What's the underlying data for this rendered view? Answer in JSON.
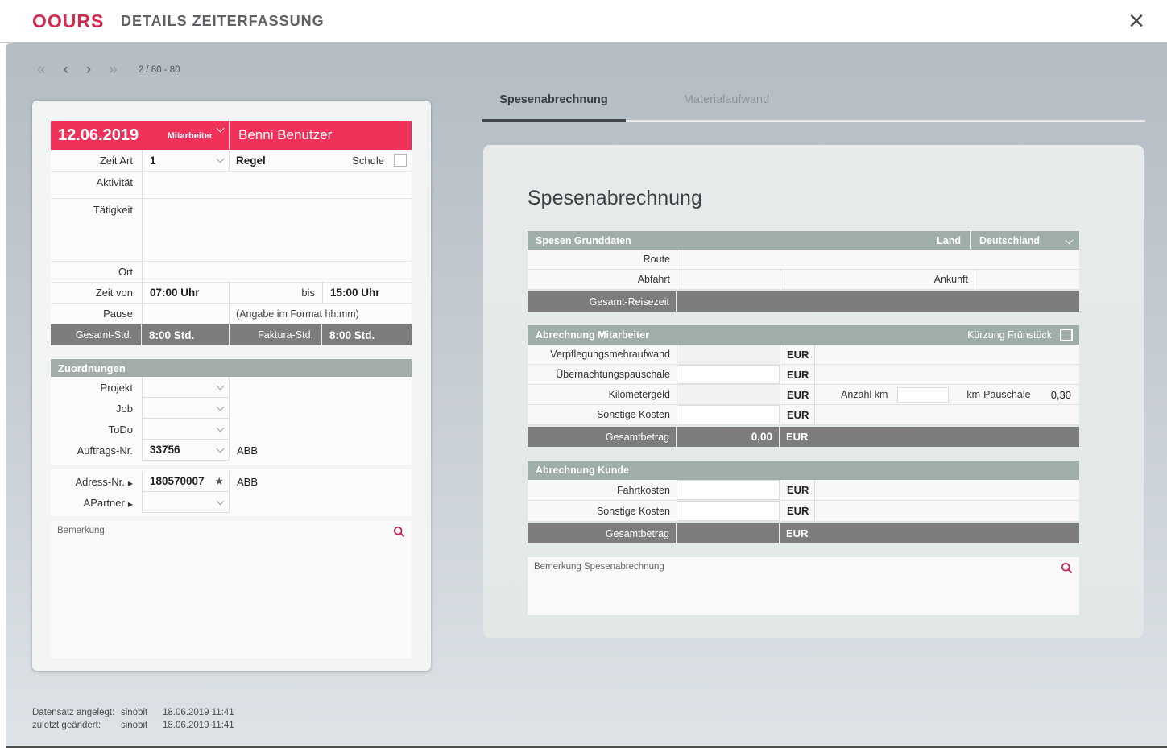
{
  "header": {
    "logo": "OOURS",
    "title": "DETAILS ZEITERFASSUNG"
  },
  "pager": {
    "first": "«",
    "prev": "‹",
    "next": "›",
    "last": "»",
    "position": "2 / 80 - 80"
  },
  "entry_card": {
    "date": "12.06.2019",
    "role_label": "Mitarbeiter",
    "user_name": "Benni Benutzer",
    "zeit_art": {
      "label": "Zeit Art",
      "value": "1",
      "type_name": "Regel",
      "schule_label": "Schule"
    },
    "aktivitaet_label": "Aktivität",
    "taetigkeit_label": "Tätigkeit",
    "ort_label": "Ort",
    "zeit_von": {
      "label": "Zeit von",
      "value": "07:00 Uhr",
      "bis_label": "bis",
      "bis_value": "15:00 Uhr"
    },
    "pause": {
      "label": "Pause",
      "hint": "(Angabe im Format hh:mm)"
    },
    "totals": {
      "gesamt_label": "Gesamt-Std.",
      "gesamt_value": "8:00 Std.",
      "faktura_label": "Faktura-Std.",
      "faktura_value": "8:00 Std."
    },
    "zuordnungen": {
      "title": "Zuordnungen",
      "projekt_label": "Projekt",
      "job_label": "Job",
      "todo_label": "ToDo",
      "auftrag_label": "Auftrags-Nr.",
      "auftrag_value": "33756",
      "auftrag_info": "ABB"
    },
    "adresse": {
      "adress_label": "Adress-Nr.",
      "adress_value": "180570007",
      "adress_info": "ABB",
      "apartner_label": "APartner",
      "arrow": "▶",
      "star": "★"
    },
    "bemerkung_label": "Bemerkung"
  },
  "tabs": [
    {
      "label": "Spesenabrechnung",
      "active": true
    },
    {
      "label": "Materialaufwand",
      "active": false
    }
  ],
  "expense_panel": {
    "title": "Spesenabrechnung",
    "currency": "EUR",
    "grunddaten": {
      "title": "Spesen Grunddaten",
      "land_label": "Land",
      "land_value": "Deutschland",
      "route_label": "Route",
      "abfahrt_label": "Abfahrt",
      "ankunft_label": "Ankunft",
      "reisezeit_label": "Gesamt-Reisezeit"
    },
    "mitarbeiter": {
      "title": "Abrechnung Mitarbeiter",
      "kuerzung_label": "Kürzung Frühstück",
      "rows": [
        {
          "label": "Verpflegungsmehraufwand"
        },
        {
          "label": "Übernachtungspauschale"
        },
        {
          "label": "Kilometergeld"
        },
        {
          "label": "Sonstige Kosten"
        }
      ],
      "anzahl_km_label": "Anzahl km",
      "km_pauschale_label": "km-Pauschale",
      "km_pauschale_value": "0,30",
      "gesamt_label": "Gesamtbetrag",
      "gesamt_value": "0,00"
    },
    "kunde": {
      "title": "Abrechnung Kunde",
      "rows": [
        {
          "label": "Fahrtkosten"
        },
        {
          "label": "Sonstige Kosten"
        }
      ],
      "gesamt_label": "Gesamtbetrag"
    },
    "bemerkung_label": "Bemerkung Spesenabrechnung"
  },
  "footer": {
    "created_label": "Datensatz angelegt:",
    "created_user": "sinobit",
    "created_at": "18.06.2019 11:41",
    "modified_label": "zuletzt geändert:",
    "modified_user": "sinobit",
    "modified_at": "18.06.2019 11:41"
  },
  "colors": {
    "accent_red": "#f0325a",
    "section_header": "#a0aeab",
    "dark_bar": "#7d7d7d",
    "search_icon": "#c2204a"
  }
}
